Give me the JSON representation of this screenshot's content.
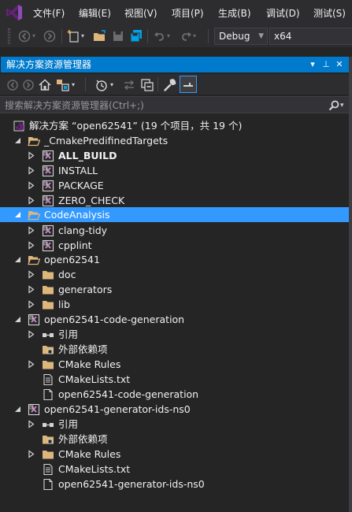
{
  "menu": {
    "items": [
      "文件(F)",
      "编辑(E)",
      "视图(V)",
      "项目(P)",
      "生成(B)",
      "调试(D)",
      "测试(S)"
    ]
  },
  "toolbar": {
    "config": "Debug",
    "platform": "x64"
  },
  "panel": {
    "title": "解决方案资源管理器",
    "pin_glyph": "▾",
    "autohide_glyph": "⊥",
    "close_glyph": "✕"
  },
  "search": {
    "placeholder": "搜索解决方案资源管理器(Ctrl+;)"
  },
  "tree": {
    "solution": "解决方案 “open62541” (19 个项目，共 19 个)",
    "predefined_folder": "_CmakePredifinedTargets",
    "all_build": "ALL_BUILD",
    "install": "INSTALL",
    "package": "PACKAGE",
    "zero_check": "ZERO_CHECK",
    "code_analysis": "CodeAnalysis",
    "clang_tidy": "clang-tidy",
    "cpplint": "cpplint",
    "open_folder": "open62541",
    "doc": "doc",
    "generators": "generators",
    "lib": "lib",
    "codegen_project": "open62541-code-generation",
    "codegen_refs": "引用",
    "codegen_external": "外部依赖项",
    "codegen_rules": "CMake Rules",
    "codegen_cmakelists": "CMakeLists.txt",
    "codegen_file": "open62541-code-generation",
    "ids_project": "open62541-generator-ids-ns0",
    "ids_refs": "引用",
    "ids_external": "外部依赖项",
    "ids_rules": "CMake Rules",
    "ids_cmakelists": "CMakeLists.txt",
    "ids_file": "open62541-generator-ids-ns0"
  },
  "colors": {
    "accent": "#007acc",
    "selection": "#3399ff",
    "background": "#252526",
    "folder": "#dcb67a"
  }
}
